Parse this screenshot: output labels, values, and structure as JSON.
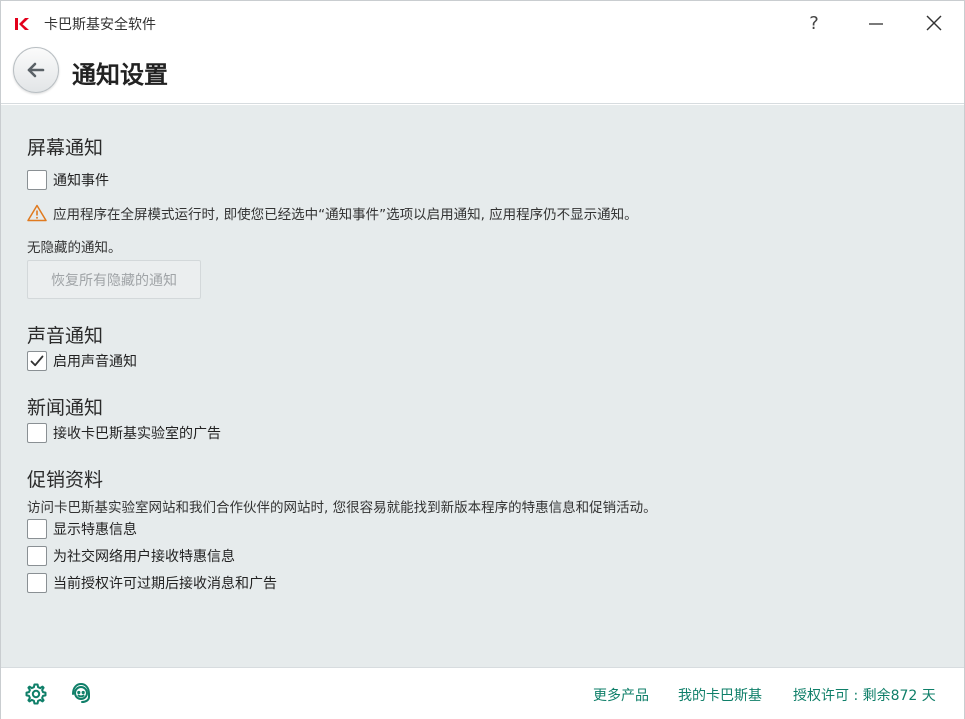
{
  "window": {
    "title": "卡巴斯基安全软件",
    "help_label": "?"
  },
  "header": {
    "title": "通知设置"
  },
  "screen_notifications": {
    "title": "屏幕通知",
    "notify_events": {
      "label": "通知事件",
      "checked": false
    },
    "warning": "应用程序在全屏模式运行时, 即使您已经选中“通知事件”选项以启用通知, 应用程序仍不显示通知。",
    "hidden_status": "无隐藏的通知。",
    "restore_button": "恢复所有隐藏的通知"
  },
  "sound_notifications": {
    "title": "声音通知",
    "enable_sound": {
      "label": "启用声音通知",
      "checked": true
    }
  },
  "news_notifications": {
    "title": "新闻通知",
    "receive_ads": {
      "label": "接收卡巴斯基实验室的广告",
      "checked": false
    }
  },
  "promo": {
    "title": "促销资料",
    "description": "访问卡巴斯基实验室网站和我们合作伙伴的网站时, 您很容易就能找到新版本程序的特惠信息和促销活动。",
    "options": [
      {
        "label": "显示特惠信息",
        "checked": false
      },
      {
        "label": "为社交网络用户接收特惠信息",
        "checked": false
      },
      {
        "label": "当前授权许可过期后接收消息和广告",
        "checked": false
      }
    ]
  },
  "footer": {
    "more_products": "更多产品",
    "my_kaspersky": "我的卡巴斯基",
    "license": "授权许可 : 剩余872 天"
  },
  "colors": {
    "accent": "#0f7f69",
    "brand": "#e3001b",
    "warning": "#e07a1f",
    "content_bg": "#e6ebec"
  },
  "icons": {
    "logo": "kaspersky-logo",
    "back": "arrow-left-icon",
    "warning": "warning-triangle-icon",
    "settings": "gear-icon",
    "support": "support-agent-icon"
  }
}
